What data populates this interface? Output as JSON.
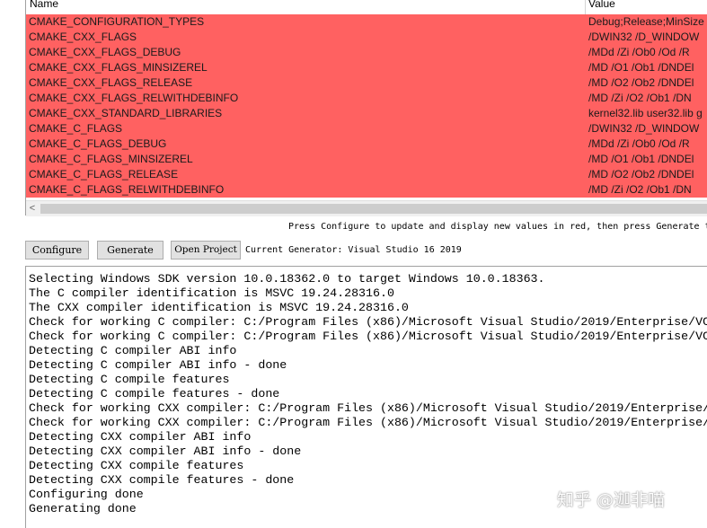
{
  "table": {
    "headers": {
      "name": "Name",
      "value": "Value"
    },
    "rows": [
      {
        "name": "CMAKE_CONFIGURATION_TYPES",
        "value": "Debug;Release;MinSize"
      },
      {
        "name": "CMAKE_CXX_FLAGS",
        "value": "/DWIN32 /D_WINDOW"
      },
      {
        "name": "CMAKE_CXX_FLAGS_DEBUG",
        "value": "/MDd /Zi /Ob0 /Od /R"
      },
      {
        "name": "CMAKE_CXX_FLAGS_MINSIZEREL",
        "value": "/MD /O1 /Ob1 /DNDEl"
      },
      {
        "name": "CMAKE_CXX_FLAGS_RELEASE",
        "value": "/MD /O2 /Ob2 /DNDEl"
      },
      {
        "name": "CMAKE_CXX_FLAGS_RELWITHDEBINFO",
        "value": "/MD /Zi /O2 /Ob1 /DN"
      },
      {
        "name": "CMAKE_CXX_STANDARD_LIBRARIES",
        "value": "kernel32.lib user32.lib g"
      },
      {
        "name": "CMAKE_C_FLAGS",
        "value": "/DWIN32 /D_WINDOW"
      },
      {
        "name": "CMAKE_C_FLAGS_DEBUG",
        "value": "/MDd /Zi /Ob0 /Od /R"
      },
      {
        "name": "CMAKE_C_FLAGS_MINSIZEREL",
        "value": "/MD /O1 /Ob1 /DNDEl"
      },
      {
        "name": "CMAKE_C_FLAGS_RELEASE",
        "value": "/MD /O2 /Ob2 /DNDEl"
      },
      {
        "name": "CMAKE_C_FLAGS_RELWITHDEBINFO",
        "value": "/MD /Zi /O2 /Ob1 /DN"
      }
    ],
    "scroll_left_arrow": "<"
  },
  "hint": "Press Configure to update and display new values in red, then press Generate t",
  "buttons": {
    "configure": "Configure",
    "generate": "Generate",
    "open_project": "Open Project"
  },
  "generator": "Current Generator: Visual Studio 16 2019",
  "output_lines": [
    "Selecting Windows SDK version 10.0.18362.0 to target Windows 10.0.18363.",
    "The C compiler identification is MSVC 19.24.28316.0",
    "The CXX compiler identification is MSVC 19.24.28316.0",
    "Check for working C compiler: C:/Program Files (x86)/Microsoft Visual Studio/2019/Enterprise/VC",
    "Check for working C compiler: C:/Program Files (x86)/Microsoft Visual Studio/2019/Enterprise/VC",
    "Detecting C compiler ABI info",
    "Detecting C compiler ABI info - done",
    "Detecting C compile features",
    "Detecting C compile features - done",
    "Check for working CXX compiler: C:/Program Files (x86)/Microsoft Visual Studio/2019/Enterprise/",
    "Check for working CXX compiler: C:/Program Files (x86)/Microsoft Visual Studio/2019/Enterprise/",
    "Detecting CXX compiler ABI info",
    "Detecting CXX compiler ABI info - done",
    "Detecting CXX compile features",
    "Detecting CXX compile features - done",
    "Configuring done",
    "Generating done"
  ],
  "watermark": "知乎 @迦非喵",
  "colors": {
    "new_value_row": "#ff6161",
    "button_face": "#e1e1e1"
  }
}
